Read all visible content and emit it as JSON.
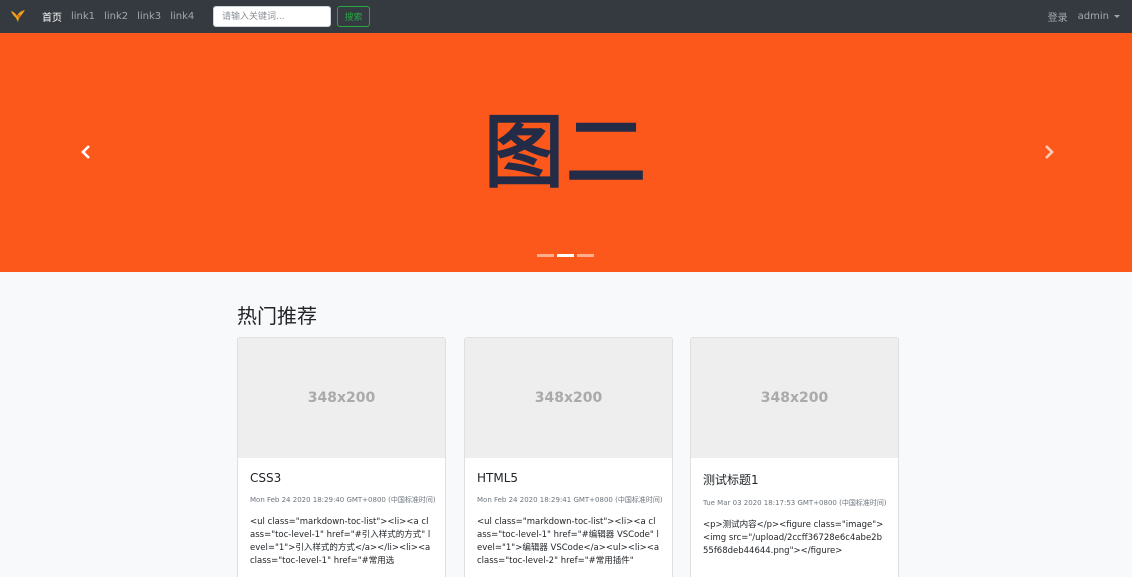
{
  "navbar": {
    "logo_icon": "bird-logo",
    "links": [
      "首页",
      "link1",
      "link2",
      "link3",
      "link4"
    ],
    "search_placeholder": "请输入关键词...",
    "search_button": "搜索",
    "login": "登录",
    "user": "admin"
  },
  "carousel": {
    "slide_title": "图二",
    "background": "#fc581c",
    "slide_count": 3,
    "active_index": 1
  },
  "section": {
    "title": "热门推荐"
  },
  "cards": [
    {
      "image_label": "348x200",
      "title": "CSS3",
      "date": "Mon Feb 24 2020 18:29:40 GMT+0800 (中国标准时间)",
      "text": "<ul class=\"markdown-toc-list\"><li><a class=\"toc-level-1\" href=\"#引入样式的方式\" level=\"1\">引入样式的方式</a></li><li><a class=\"toc-level-1\" href=\"#常用选"
    },
    {
      "image_label": "348x200",
      "title": "HTML5",
      "date": "Mon Feb 24 2020 18:29:41 GMT+0800 (中国标准时间)",
      "text": "<ul class=\"markdown-toc-list\"><li><a class=\"toc-level-1\" href=\"#编辑器 VSCode\" level=\"1\">编辑器 VSCode</a><ul><li><a class=\"toc-level-2\" href=\"#常用插件\""
    },
    {
      "image_label": "348x200",
      "title": "测试标题1",
      "date": "Tue Mar 03 2020 18:17:53 GMT+0800 (中国标准时间)",
      "text": "<p>测试内容</p><figure class=\"image\"><img src=\"/upload/2ccff36728e6c4abe2b55f68deb44644.png\"></figure>"
    }
  ]
}
